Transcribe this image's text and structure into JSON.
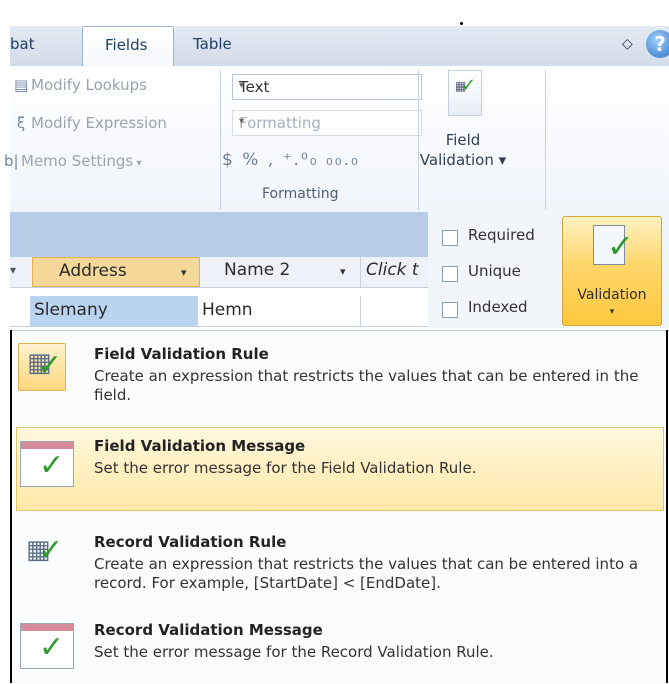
{
  "ribbon": {
    "tabs": [
      {
        "label": "bat"
      },
      {
        "label": "Fields",
        "active": true
      },
      {
        "label": "Table"
      }
    ],
    "properties_group": {
      "buttons": [
        {
          "label": "Modify Lookups",
          "icon": "lookup-icon"
        },
        {
          "label": "Modify Expression",
          "icon": "expression-icon"
        },
        {
          "label": "Memo Settings",
          "icon": "memo-icon",
          "has_dropdown": true
        }
      ]
    },
    "formatting_group": {
      "data_type_value": "Text",
      "format_value": "Formatting",
      "symbols": "$  %  ,  ⁺.⁰₀  ₀₀.₀",
      "label": "Formatting"
    },
    "field_validation": {
      "label": "Field Validation"
    }
  },
  "datasheet": {
    "columns": [
      "Address",
      "Name 2",
      "Click t"
    ],
    "row": [
      "Slemany",
      "Hemn",
      ""
    ]
  },
  "checkboxes": [
    {
      "label": "Required",
      "checked": false
    },
    {
      "label": "Unique",
      "checked": false
    },
    {
      "label": "Indexed",
      "checked": false
    }
  ],
  "validation_button": {
    "label": "Validation"
  },
  "menu": {
    "items": [
      {
        "title": "Field Validation Rule",
        "accel": "F",
        "desc": "Create an expression that restricts the values that can be entered in the field."
      },
      {
        "title": "Field Validation Message",
        "accel": "V",
        "desc": "Set the error message for the Field Validation Rule.",
        "highlighted": true
      },
      {
        "title": "Record Validation Rule",
        "accel": "R",
        "desc": "Create an expression that restricts the values that can be entered into a record.  For example, [StartDate] < [EndDate]."
      },
      {
        "title": "Record Validation Message",
        "accel": "M",
        "desc": "Set the error message for the Record Validation Rule."
      }
    ]
  },
  "colors": {
    "accent_highlight": "#ffd66a",
    "header_blue": "#b8cbe7",
    "check_green": "#2f9a2f"
  }
}
